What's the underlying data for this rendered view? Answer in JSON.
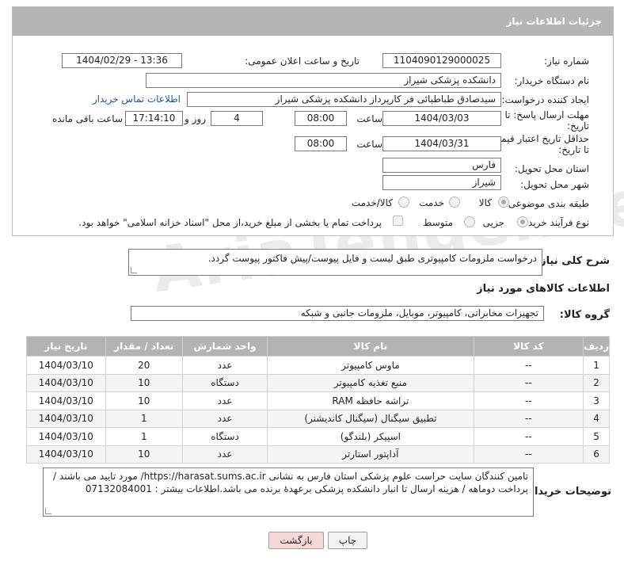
{
  "header": {
    "title": "جزئیات اطلاعات نیاز"
  },
  "form": {
    "need_number_label": "شماره نیاز:",
    "need_number": "1104090129000025",
    "announce_label": "تاریخ و ساعت اعلان عمومی:",
    "announce_value": "1404/02/29 - 13:36",
    "buyer_org_label": "نام دستگاه خریدار:",
    "buyer_org": "دانشکده پزشکی شیراز",
    "requester_label": "ایجاد کننده درخواست:",
    "requester": "سیدصادق طباطبائی فر کارپرداز دانشکده پزشکی شیراز",
    "contact_link": "اطلاعات تماس خریدار",
    "reply_deadline_label_1": "مهلت ارسال پاسخ: تا",
    "reply_deadline_label_2": "تاریخ:",
    "reply_date": "1404/03/03",
    "time_label": "ساعت",
    "reply_time": "08:00",
    "days_value": "4",
    "days_label": "روز و",
    "remaining_time": "17:14:10",
    "remaining_label": "ساعت باقی مانده",
    "price_valid_label_1": "حداقل تاریخ اعتبار قیمت:",
    "price_valid_label_2": "تا تاریخ:",
    "price_date": "1404/03/31",
    "price_time": "08:00",
    "province_label": "استان محل تحویل:",
    "province": "فارس",
    "city_label": "شهر محل تحویل:",
    "city": "شیراز",
    "category_label": "طبقه بندی موضوعی:",
    "category_options": [
      "کالا",
      "خدمت",
      "کالا/خدمت"
    ],
    "process_label": "نوع فرآیند خرید :",
    "process_options": [
      "جزیی",
      "متوسط"
    ],
    "payment_note": "پرداخت تمام یا بخشی از مبلغ خرید،از محل \"اسناد خزانه اسلامی\" خواهد بود."
  },
  "summary": {
    "label": "شرح کلی نیاز:",
    "text": "درخواست ملزومات کامپیوتری طبق لیست و فایل پیوست/پیش فاکتور پیوست گردد."
  },
  "goods": {
    "section_title": "اطلاعات کالاهای مورد نیاز",
    "group_label": "گروه کالا:",
    "group_value": "تجهیزات مخابراتی، کامپیوتر، موبایل، ملزومات جانبی و شبکه",
    "columns": [
      "ردیف",
      "کد کالا",
      "نام کالا",
      "واحد شمارش",
      "تعداد / مقدار",
      "تاریخ نیاز"
    ],
    "rows": [
      {
        "idx": "1",
        "code": "--",
        "name": "ماوس کامپیوتر",
        "unit": "عدد",
        "qty": "20",
        "date": "1404/03/10"
      },
      {
        "idx": "2",
        "code": "--",
        "name": "منبع تغذیه کامپیوتر",
        "unit": "دستگاه",
        "qty": "10",
        "date": "1404/03/10"
      },
      {
        "idx": "3",
        "code": "--",
        "name": "تراشه حافظه RAM",
        "unit": "عدد",
        "qty": "10",
        "date": "1404/03/10"
      },
      {
        "idx": "4",
        "code": "--",
        "name": "تطبیق سیگنال (سیگنال کاندیشنر)",
        "unit": "عدد",
        "qty": "1",
        "date": "1404/03/10"
      },
      {
        "idx": "5",
        "code": "--",
        "name": "اسپیکر (بلندگو)",
        "unit": "دستگاه",
        "qty": "1",
        "date": "1404/03/10"
      },
      {
        "idx": "6",
        "code": "--",
        "name": "آداپتور استارتر",
        "unit": "عدد",
        "qty": "10",
        "date": "1404/03/10"
      }
    ]
  },
  "buyer_notes": {
    "label": "توضیحات خریدار:",
    "text": "تامین کنندگان سایت حراست علوم پزشکی استان فارس به نشانی https://harasat.sums.ac.ir/ مورد تایید می باشند / پرداخت دوماهه / هزینه ارسال تا انبار دانشکده پزشکی برعهدۀ برنده می باشد.اطلاعات بیشتر : 07132084001"
  },
  "buttons": {
    "print": "چاپ",
    "back": "بازگشت"
  },
  "watermark": "AriaTender.neT"
}
